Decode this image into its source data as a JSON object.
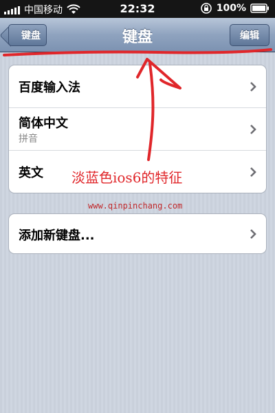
{
  "status": {
    "carrier": "中国移动",
    "time": "22:32",
    "battery": "100%"
  },
  "nav": {
    "back_label": "键盘",
    "title": "键盘",
    "edit_label": "编辑"
  },
  "keyboards": [
    {
      "label": "百度输入法",
      "sub": ""
    },
    {
      "label": "简体中文",
      "sub": "拼音"
    },
    {
      "label": "英文",
      "sub": ""
    }
  ],
  "add_keyboard": {
    "label": "添加新键盘..."
  },
  "annotation": {
    "text": "淡蓝色ios6的特征",
    "watermark": "www.qinpinchang.com",
    "color": "#e0262a"
  }
}
